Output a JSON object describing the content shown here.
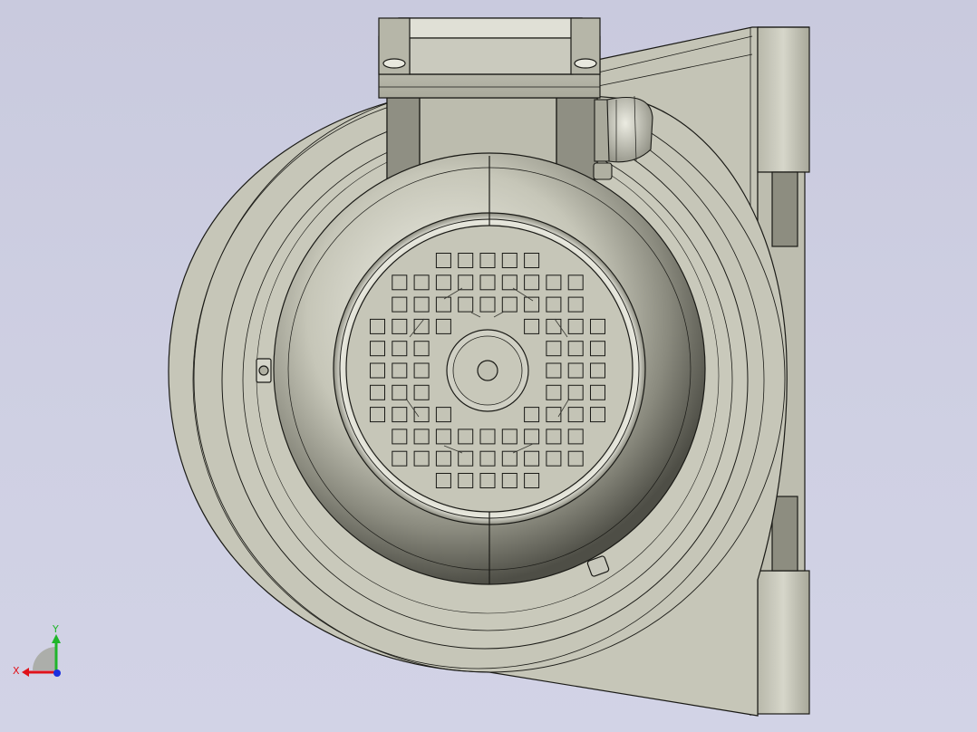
{
  "viewport": {
    "background_top": "#c9cade",
    "background_bottom": "#d2d3e6",
    "model_fill": "#c9c9bb",
    "model_dark": "#6d6d63",
    "edge_color": "#1a1a16"
  },
  "triad": {
    "x_label": "X",
    "y_label": "Y",
    "x_color": "#e0121a",
    "y_color": "#1fb52a",
    "z_color": "#1a2fe0"
  },
  "icons": [
    "coordinate-triad-icon"
  ]
}
